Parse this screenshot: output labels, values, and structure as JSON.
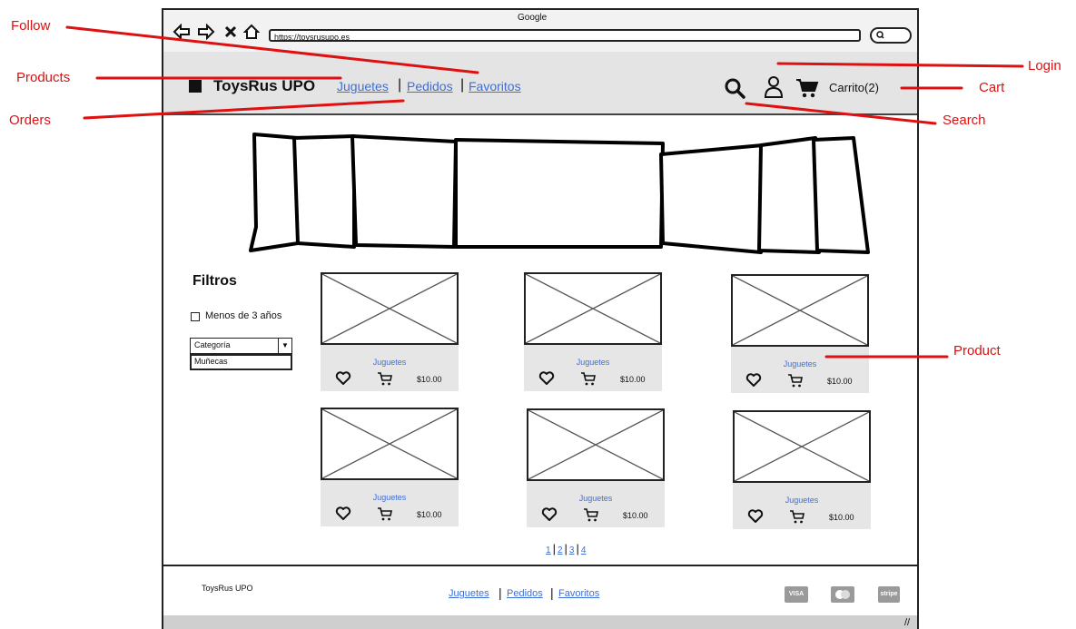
{
  "browser": {
    "title": "Google",
    "url": "https://toysrusupo.es"
  },
  "header": {
    "brand": "ToysRus UPO",
    "nav": [
      "Juguetes",
      "Pedidos",
      "Favoritos"
    ],
    "separator": "|",
    "cart_label": "Carrito(2)"
  },
  "filters": {
    "title": "Filtros",
    "checkbox_label": "Menos de 3 años",
    "category_select": "Categoría",
    "category_option": "Muñecas"
  },
  "products": [
    {
      "category": "Juguetes",
      "price": "$10.00"
    },
    {
      "category": "Juguetes",
      "price": "$10.00"
    },
    {
      "category": "Juguetes",
      "price": "$10.00"
    },
    {
      "category": "Juguetes",
      "price": "$10.00"
    },
    {
      "category": "Juguetes",
      "price": "$10.00"
    },
    {
      "category": "Juguetes",
      "price": "$10.00"
    }
  ],
  "pagination": [
    "1",
    "2",
    "3",
    "4"
  ],
  "footer": {
    "brand": "ToysRus UPO",
    "links": [
      "Juguetes",
      "Pedidos",
      "Favoritos"
    ],
    "payments": [
      "VISA",
      "MasterCard",
      "stripe"
    ]
  },
  "annotations": {
    "follow": "Follow",
    "products": "Products",
    "orders": "Orders",
    "login": "Login",
    "cart": "Cart",
    "search": "Search",
    "product": "Product"
  },
  "colors": {
    "link": "#3d6fd8",
    "annotation": "#dd1111",
    "header_bg": "#e4e4e4",
    "card_panel": "#e6e6e6"
  },
  "icons": [
    "back-arrow-icon",
    "forward-arrow-icon",
    "close-icon",
    "home-icon",
    "search-icon",
    "user-icon",
    "cart-icon",
    "heart-icon"
  ]
}
